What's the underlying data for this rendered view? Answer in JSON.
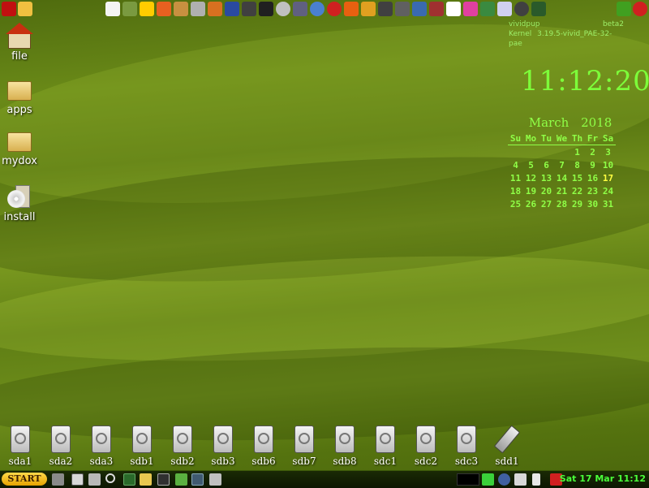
{
  "topbar": {
    "icons": [
      "menu-down-arrow-icon",
      "notes-icon",
      "cow-icon",
      "drive-icon",
      "brightness-icon",
      "disc-burner-icon",
      "xwindow-icon",
      "tools-icon",
      "package-icon",
      "save-icon",
      "camera-icon",
      "cross-icon",
      "webcam-icon",
      "network-icon",
      "chrome-icon",
      "opera-icon",
      "vlc-icon",
      "pencils-icon",
      "camera-icon-2",
      "media-icon",
      "monitor-icon",
      "flag-icon",
      "pointer-icon",
      "color-icon",
      "wizard-icon",
      "chart-icon",
      "clock-icon",
      "scanner-icon"
    ],
    "right_icons": [
      "refresh-icon",
      "power-icon"
    ]
  },
  "desktop": {
    "icons": [
      {
        "label": "file",
        "icon": "home-icon"
      },
      {
        "label": "apps",
        "icon": "folder-icon"
      },
      {
        "label": "mydox",
        "icon": "folder-icon"
      },
      {
        "label": "install",
        "icon": "install-disc-icon"
      }
    ]
  },
  "sysinfo": {
    "distro": "vividpup",
    "version": "beta2",
    "kernel_label": "Kernel",
    "kernel": "3.19.5-vivid_PAE-32-pae"
  },
  "clock": {
    "time": "11:12:20"
  },
  "calendar": {
    "month": "March",
    "year": "2018",
    "weekdays": [
      "Su",
      "Mo",
      "Tu",
      "We",
      "Th",
      "Fr",
      "Sa"
    ],
    "weeks": [
      [
        "",
        "",
        "",
        "",
        "1",
        "2",
        "3"
      ],
      [
        "4",
        "5",
        "6",
        "7",
        "8",
        "9",
        "10"
      ],
      [
        "11",
        "12",
        "13",
        "14",
        "15",
        "16",
        "17"
      ],
      [
        "18",
        "19",
        "20",
        "21",
        "22",
        "23",
        "24"
      ],
      [
        "25",
        "26",
        "27",
        "28",
        "29",
        "30",
        "31"
      ]
    ],
    "today": "17"
  },
  "drives": [
    "sda1",
    "sda2",
    "sda3",
    "sdb1",
    "sdb2",
    "sdb3",
    "sdb6",
    "sdb7",
    "sdb8",
    "sdc1",
    "sdc2",
    "sdc3",
    "sdd1"
  ],
  "taskbar": {
    "start_label": "START",
    "datetime": "Sat 17 Mar 11:12"
  }
}
